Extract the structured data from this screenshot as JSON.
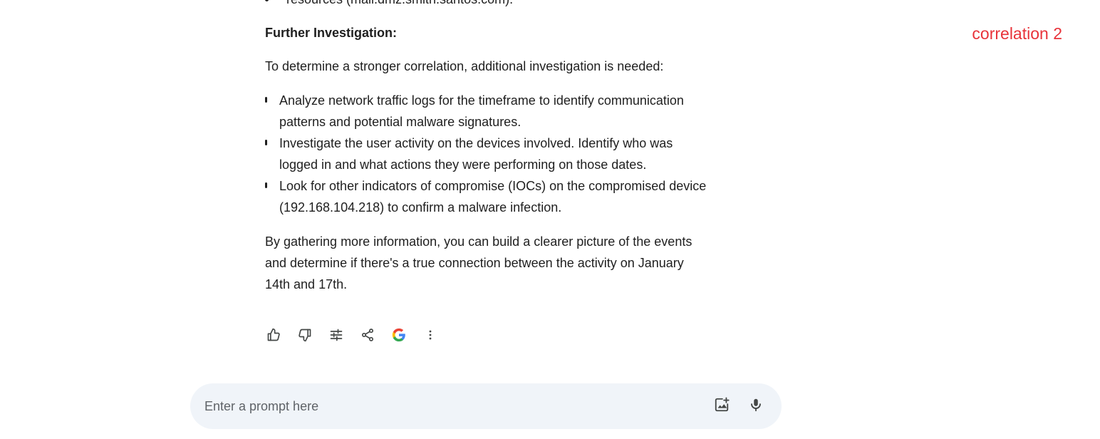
{
  "response": {
    "partial_line": "resources (mail.dmz.smith.santos.com).",
    "heading": "Further Investigation:",
    "intro": "To determine a stronger correlation, additional investigation is needed:",
    "bullets": [
      "Analyze network traffic logs for the timeframe to identify communication patterns and potential malware signatures.",
      "Investigate the user activity on the devices involved. Identify who was logged in and what actions they were performing on those dates.",
      "Look for other indicators of compromise (IOCs) on the compromised device (192.168.104.218) to confirm a malware infection."
    ],
    "conclusion": "By gathering more information, you can build a clearer picture of the events and determine if there's a true connection between the activity on January 14th and 17th."
  },
  "actions": {
    "icons": [
      "thumbs-up-icon",
      "thumbs-down-icon",
      "tune-icon",
      "share-icon",
      "google-icon",
      "more-vert-icon"
    ]
  },
  "prompt": {
    "placeholder": "Enter a prompt here",
    "value": "",
    "icons": [
      "add-image-icon",
      "microphone-icon"
    ]
  },
  "annotation": {
    "text": "correlation 2",
    "color": "#e8333a"
  },
  "colors": {
    "text": "#1f1f1f",
    "icon": "#444746",
    "prompt_bg": "#f0f4f9",
    "google_blue": "#4285F4",
    "google_red": "#EA4335",
    "google_yellow": "#FBBC05",
    "google_green": "#34A853"
  }
}
